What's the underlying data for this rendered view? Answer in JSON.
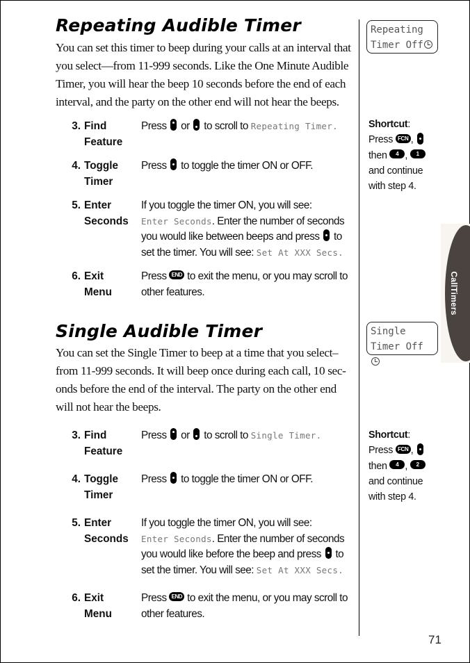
{
  "side_tab": {
    "label": "CallTimers"
  },
  "page_number": "71",
  "sections": [
    {
      "title": "Repeating Audible Timer",
      "intro": "You can set this timer to beep during your calls at an interval that you select—from 11-999 seconds. Like the One Minute Audible Timer, you will hear the beep 10 seconds before the end of each interval, and the party on the other end will not hear the beeps.",
      "display": {
        "line1": "Repeating",
        "line2": "Timer Off",
        "icon": "clock-icon"
      },
      "steps": [
        {
          "num": "3.",
          "name_line1": "Find",
          "name_line2": "Feature",
          "text_a": "Press",
          "text_b": "or",
          "text_c": "to scroll to",
          "lcd": "Repeating Timer",
          "text_d": "."
        },
        {
          "num": "4.",
          "name_line1": "Toggle",
          "name_line2": "Timer",
          "text_a": "Press",
          "text_b": "to toggle the timer ON or OFF."
        },
        {
          "num": "5.",
          "name_line1": "Enter",
          "name_line2": "Seconds",
          "text_a": "If you toggle the timer ON, you will see:",
          "lcd1": "Enter Seconds",
          "text_b": ". Enter the number of seconds you would like between beeps and press",
          "text_c": "to set the timer. You will see:",
          "lcd2": "Set At XXX Secs",
          "text_d": "."
        },
        {
          "num": "6.",
          "name_line1": "Exit",
          "name_line2": "Menu",
          "text_a": "Press",
          "key": "END",
          "text_b": "to exit the menu, or you may scroll to other features."
        }
      ],
      "shortcut": {
        "label": "Shortcut",
        "press": "Press",
        "fcn": "FCN",
        "then": "then",
        "key1": "4",
        "key2": "1",
        "line3": "and continue",
        "line4": "with step 4."
      }
    },
    {
      "title": "Single Audible Timer",
      "intro": "You can set the Single Timer to beep at a time that you select– from 11-999 seconds. It will beep once during each call, 10 sec- onds before the end of the interval. The party on the other end will not hear the beeps.",
      "display": {
        "line1": "Single",
        "line2": "Timer Off",
        "icon": "clock-icon"
      },
      "steps": [
        {
          "num": "3.",
          "name_line1": "Find",
          "name_line2": "Feature",
          "text_a": "Press",
          "text_b": "or",
          "text_c": "to scroll to",
          "lcd": "Single Timer",
          "text_d": "."
        },
        {
          "num": "4.",
          "name_line1": "Toggle",
          "name_line2": "Timer",
          "text_a": "Press",
          "text_b": "to toggle the timer ON or OFF."
        },
        {
          "num": "5.",
          "name_line1": "Enter",
          "name_line2": "Seconds",
          "text_a": "If you toggle the timer ON, you will see:",
          "lcd1": "Enter Seconds",
          "text_b": ". Enter the number of seconds you would like before the beep and press",
          "text_c": "to set the timer. You will see:",
          "lcd2": "Set At XXX Secs",
          "text_d": "."
        },
        {
          "num": "6.",
          "name_line1": "Exit",
          "name_line2": "Menu",
          "text_a": "Press",
          "key": "END",
          "text_b": "to exit the menu, or you may scroll to other features."
        }
      ],
      "shortcut": {
        "label": "Shortcut",
        "press": "Press",
        "fcn": "FCN",
        "then": "then",
        "key1": "4",
        "key2": "2",
        "line3": "and continue",
        "line4": "with step 4."
      }
    }
  ]
}
